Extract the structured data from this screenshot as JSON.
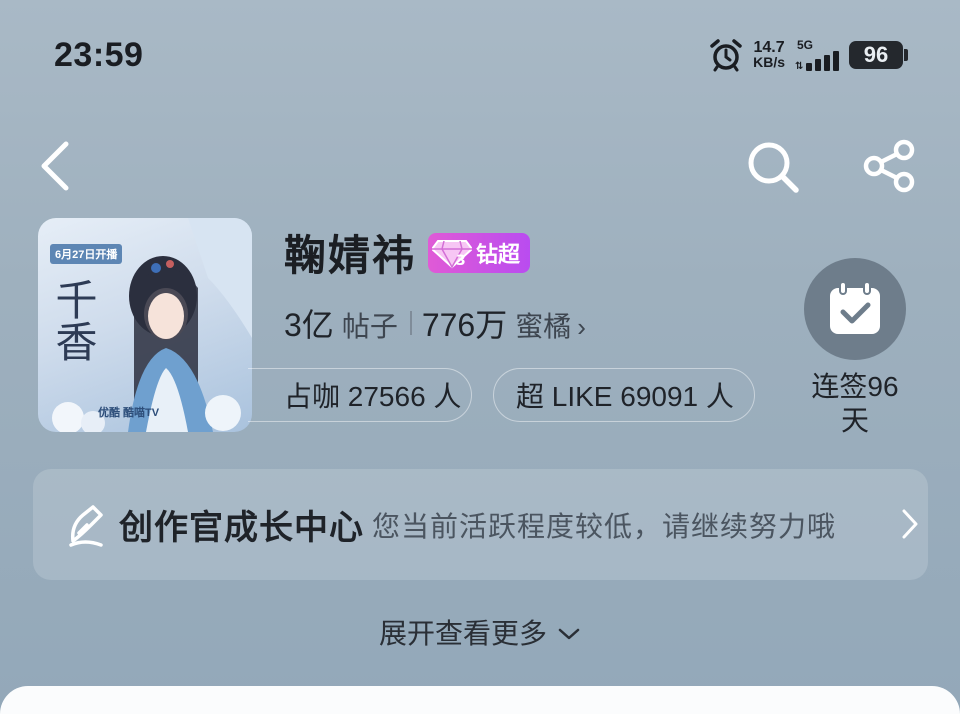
{
  "status_bar": {
    "time": "23:59",
    "net_speed_value": "14.7",
    "net_speed_unit": "KB/s",
    "network_type": "5G",
    "battery": "96"
  },
  "cover": {
    "date_badge": "6月27日开播",
    "calligraphy": "千香",
    "brands": "优酷  酷喵TV"
  },
  "header": {
    "title": "鞠婧祎",
    "badge_label": "钻超",
    "badge_level": "3"
  },
  "stats": {
    "posts_value": "3亿",
    "posts_label": "帖子",
    "fans_value": "776万",
    "fans_label": "蜜橘",
    "chevron": "›"
  },
  "pills": {
    "checkin_count": "占咖 27566 人",
    "super_like": "超 LIKE 69091 人"
  },
  "checkin": {
    "label": "连签96天"
  },
  "creator_center": {
    "title": "创作官成长中心",
    "subtitle": "您当前活跃程度较低，请继续努力哦"
  },
  "expand": {
    "label": "展开查看更多"
  },
  "icons": {
    "back": "back-arrow-icon",
    "search": "search-icon",
    "share": "share-icon",
    "alarm": "alarm-icon",
    "calendar_check": "calendar-check-icon",
    "creator": "creator-pen-icon",
    "expand": "chevron-down-icon"
  },
  "colors": {
    "badge_start": "#e05ad6",
    "badge_end": "#b94cf0",
    "background_top": "#a9b9c6",
    "background_bottom": "#93a8b9"
  }
}
